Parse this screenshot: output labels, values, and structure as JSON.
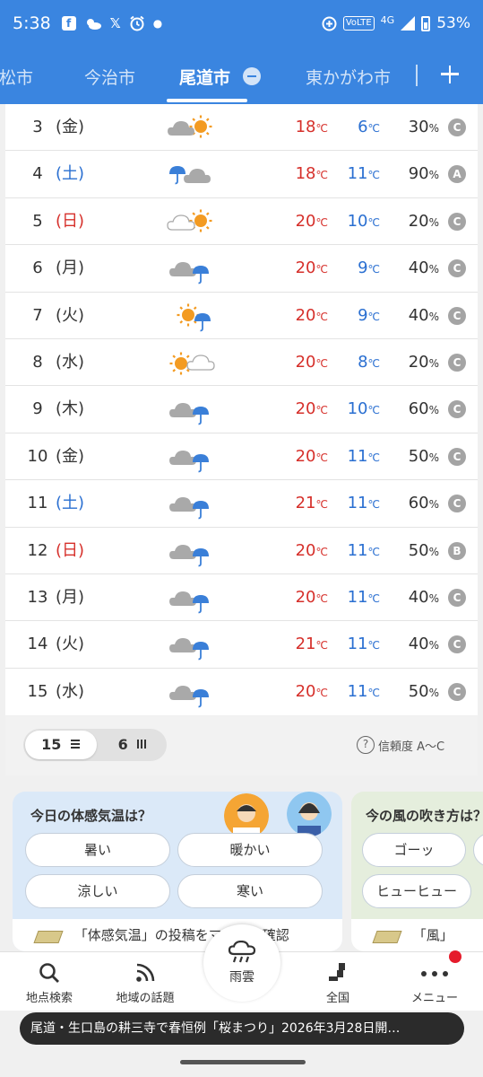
{
  "status": {
    "time": "5:38",
    "network": "4G",
    "volte": "VoLTE",
    "battery": "53%",
    "notif_icons": [
      "facebook-icon",
      "weather-icon",
      "x-icon",
      "alarm-icon",
      "dot-icon"
    ]
  },
  "tabs": [
    {
      "label": "高松市",
      "active": false
    },
    {
      "label": "今治市",
      "active": false
    },
    {
      "label": "尾道市",
      "active": true
    },
    {
      "label": "東かがわ市",
      "active": false
    }
  ],
  "units": {
    "temp": "℃",
    "prec": "%"
  },
  "forecast": [
    {
      "day": "3",
      "dow": "(金)",
      "dow_type": "weekday",
      "icon": "cloud-sun",
      "high": "18",
      "low": "6",
      "precip": "30",
      "rel": "C"
    },
    {
      "day": "4",
      "dow": "(土)",
      "dow_type": "sat",
      "icon": "rain-cloud",
      "high": "18",
      "low": "11",
      "precip": "90",
      "rel": "A"
    },
    {
      "day": "5",
      "dow": "(日)",
      "dow_type": "sun",
      "icon": "cloud-sun",
      "high": "20",
      "low": "10",
      "precip": "20",
      "rel": "C"
    },
    {
      "day": "6",
      "dow": "(月)",
      "dow_type": "weekday",
      "icon": "cloud-rain",
      "high": "20",
      "low": "9",
      "precip": "40",
      "rel": "C"
    },
    {
      "day": "7",
      "dow": "(火)",
      "dow_type": "weekday",
      "icon": "sun-rain",
      "high": "20",
      "low": "9",
      "precip": "40",
      "rel": "C"
    },
    {
      "day": "8",
      "dow": "(水)",
      "dow_type": "weekday",
      "icon": "sun-cloud",
      "high": "20",
      "low": "8",
      "precip": "20",
      "rel": "C"
    },
    {
      "day": "9",
      "dow": "(木)",
      "dow_type": "weekday",
      "icon": "cloud-rain",
      "high": "20",
      "low": "10",
      "precip": "60",
      "rel": "C"
    },
    {
      "day": "10",
      "dow": "(金)",
      "dow_type": "weekday",
      "icon": "cloud-rain",
      "high": "20",
      "low": "11",
      "precip": "50",
      "rel": "C"
    },
    {
      "day": "11",
      "dow": "(土)",
      "dow_type": "sat",
      "icon": "cloud-rain",
      "high": "21",
      "low": "11",
      "precip": "60",
      "rel": "C"
    },
    {
      "day": "12",
      "dow": "(日)",
      "dow_type": "sun",
      "icon": "cloud-rain",
      "high": "20",
      "low": "11",
      "precip": "50",
      "rel": "B"
    },
    {
      "day": "13",
      "dow": "(月)",
      "dow_type": "weekday",
      "icon": "cloud-rain",
      "high": "20",
      "low": "11",
      "precip": "40",
      "rel": "C"
    },
    {
      "day": "14",
      "dow": "(火)",
      "dow_type": "weekday",
      "icon": "cloud-rain",
      "high": "21",
      "low": "11",
      "precip": "40",
      "rel": "C"
    },
    {
      "day": "15",
      "dow": "(水)",
      "dow_type": "weekday",
      "icon": "cloud-rain",
      "high": "20",
      "low": "11",
      "precip": "50",
      "rel": "C"
    }
  ],
  "viewbar": {
    "opt_15": "15",
    "opt_6": "6",
    "reliability": "信頼度 A〜C"
  },
  "card1": {
    "title": "今日の体感気温は？",
    "options": [
      "暑い",
      "暖かい",
      "涼しい",
      "寒い"
    ],
    "footer": "「体感気温」の投稿をマップで確認"
  },
  "card2": {
    "title": "今の風の吹き方は？",
    "options": [
      "ゴーッ",
      "ヒューヒュー"
    ],
    "footer": "「風」"
  },
  "nav": {
    "search": "地点検索",
    "topics": "地域の話題",
    "rain": "雨雲",
    "national": "全国",
    "menu": "メニュー"
  },
  "toast": "尾道・生口島の耕三寺で春恒例「桜まつり」2026年3月28日開…",
  "colors": {
    "brand": "#3a85e0",
    "high": "#d6302b",
    "low": "#2a6fd1",
    "reliability": "#a4a4a4"
  }
}
